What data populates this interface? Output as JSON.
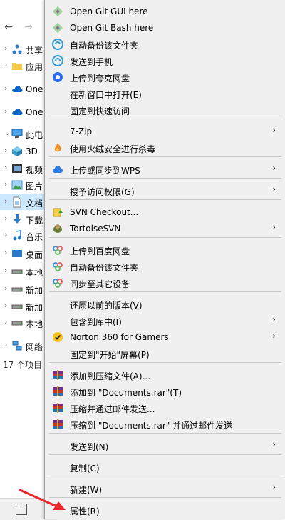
{
  "explorer": {
    "nav": {
      "back": "←",
      "forward": "→"
    },
    "tree": [
      {
        "label": "共享",
        "icon": "network-share-icon",
        "expanded": false
      },
      {
        "label": "应用",
        "icon": "folder-icon",
        "expanded": false
      },
      {
        "label": "One",
        "icon": "onedrive-icon",
        "expanded": false
      },
      {
        "label": "One",
        "icon": "onedrive-icon",
        "expanded": false
      },
      {
        "label": "此电",
        "icon": "pc-icon",
        "expanded": true
      },
      {
        "label": "3D",
        "icon": "3d-objects-icon",
        "expanded": false
      },
      {
        "label": "视频",
        "icon": "video-icon",
        "expanded": false
      },
      {
        "label": "图片",
        "icon": "pictures-icon",
        "expanded": false
      },
      {
        "label": "文档",
        "icon": "documents-icon",
        "expanded": false,
        "selected": true
      },
      {
        "label": "下载",
        "icon": "download-icon",
        "expanded": false
      },
      {
        "label": "音乐",
        "icon": "music-icon",
        "expanded": false
      },
      {
        "label": "桌面",
        "icon": "desktop-icon",
        "expanded": false
      },
      {
        "label": "本地",
        "icon": "drive-icon",
        "expanded": false
      },
      {
        "label": "新加",
        "icon": "drive-icon",
        "expanded": false
      },
      {
        "label": "新加",
        "icon": "drive-icon",
        "expanded": false
      },
      {
        "label": "本地",
        "icon": "drive-icon",
        "expanded": false
      },
      {
        "label": "网络",
        "icon": "network-icon",
        "expanded": false
      }
    ],
    "status": "17 个项目"
  },
  "menu": {
    "items": [
      {
        "label": "Open Git GUI here",
        "icon": "git-icon",
        "submenu": false
      },
      {
        "label": "Open Git Bash here",
        "icon": "git-icon",
        "submenu": false
      },
      {
        "label": "自动备份该文件夹",
        "icon": "baidu-sync-icon",
        "submenu": false
      },
      {
        "label": "发送到手机",
        "icon": "baidu-sync-icon",
        "submenu": false
      },
      {
        "label": "上传到夸克网盘",
        "icon": "quark-icon",
        "submenu": false
      },
      {
        "label": "在新窗口中打开(E)",
        "icon": "",
        "submenu": false
      },
      {
        "label": "固定到快速访问",
        "icon": "",
        "submenu": false
      },
      {
        "label": "7-Zip",
        "icon": "",
        "submenu": true
      },
      {
        "label": "使用火绒安全进行杀毒",
        "icon": "huorong-icon",
        "submenu": false
      },
      {
        "label": "上传或同步到WPS",
        "icon": "wps-cloud-icon",
        "submenu": true
      },
      {
        "label": "授予访问权限(G)",
        "icon": "",
        "submenu": true
      },
      {
        "label": "SVN Checkout...",
        "icon": "svn-checkout-icon",
        "submenu": false
      },
      {
        "label": "TortoiseSVN",
        "icon": "tortoise-icon",
        "submenu": true
      },
      {
        "label": "上传到百度网盘",
        "icon": "baidu-cloud-icon",
        "submenu": false
      },
      {
        "label": "自动备份该文件夹",
        "icon": "baidu-cloud-icon",
        "submenu": false
      },
      {
        "label": "同步至其它设备",
        "icon": "baidu-cloud-icon",
        "submenu": false
      },
      {
        "label": "还原以前的版本(V)",
        "icon": "",
        "submenu": false
      },
      {
        "label": "包含到库中(I)",
        "icon": "",
        "submenu": true
      },
      {
        "label": "Norton 360 for Gamers",
        "icon": "norton-icon",
        "submenu": true
      },
      {
        "label": "固定到\"开始\"屏幕(P)",
        "icon": "",
        "submenu": false
      },
      {
        "label": "添加到压缩文件(A)...",
        "icon": "winrar-icon",
        "submenu": false
      },
      {
        "label": "添加到 \"Documents.rar\"(T)",
        "icon": "winrar-icon",
        "submenu": false
      },
      {
        "label": "压缩并通过邮件发送...",
        "icon": "winrar-icon",
        "submenu": false
      },
      {
        "label": "压缩到 \"Documents.rar\" 并通过邮件发送",
        "icon": "winrar-icon",
        "submenu": false
      },
      {
        "label": "发送到(N)",
        "icon": "",
        "submenu": true
      },
      {
        "label": "复制(C)",
        "icon": "",
        "submenu": false
      },
      {
        "label": "新建(W)",
        "icon": "",
        "submenu": true
      },
      {
        "label": "属性(R)",
        "icon": "",
        "submenu": false
      }
    ],
    "submenu_glyph": "›"
  },
  "colors": {
    "menu_bg": "#f0f0f0",
    "separator": "#c8c8c8",
    "selection": "#cce8ff",
    "annotation_arrow": "#e8262a"
  }
}
